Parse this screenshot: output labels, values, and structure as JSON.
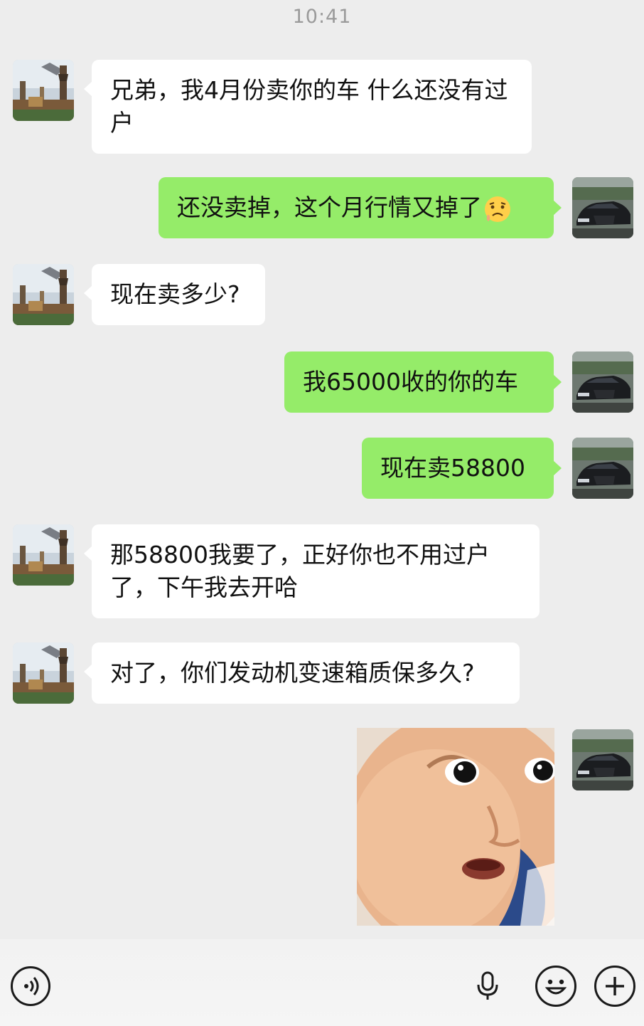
{
  "status_bar": {
    "time": "10:41"
  },
  "messages": [
    {
      "side": "left",
      "text": "兄弟，我4月份卖你的车 什么还没有过户"
    },
    {
      "side": "right",
      "text": "还没卖掉，这个月行情又掉了",
      "emoji": "sad-face"
    },
    {
      "side": "left",
      "text": "现在卖多少?"
    },
    {
      "side": "right",
      "text": "我65000收的你的车"
    },
    {
      "side": "right",
      "text": "现在卖58800"
    },
    {
      "side": "left",
      "text": "那58800我要了，正好你也不用过户了，下午我去开哈"
    },
    {
      "side": "left",
      "text": "对了，你们发动机变速箱质保多久?"
    },
    {
      "side": "right",
      "type": "sticker",
      "icon": "surprised-baby-sticker"
    }
  ],
  "input_bar": {
    "icons": [
      "voice-icon",
      "microphone-icon",
      "emoji-icon",
      "plus-icon"
    ]
  },
  "colors": {
    "background": "#ededed",
    "sent_bubble": "#95ec69",
    "received_bubble": "#ffffff"
  }
}
